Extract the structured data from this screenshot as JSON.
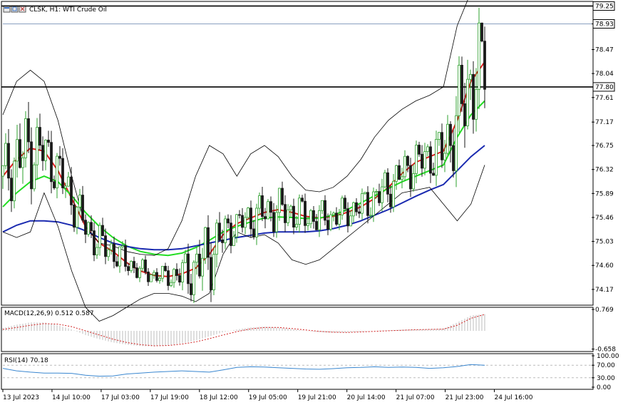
{
  "window": {
    "title": "CLSK, H1: WTI Crude Oil",
    "toolbar_icons": [
      "window-icon",
      "restore-icon",
      "close-icon"
    ]
  },
  "colors": {
    "bull": "#2ea02e",
    "bear": "#1a1a1a",
    "ma_red": "#dd1f1f",
    "ma_green": "#22dd22",
    "ma_blue": "#1a2ab0",
    "bands": "#000000",
    "grid": "#c8c8c8",
    "macd_hist": "#bdbdbd",
    "macd_signal": "#d02020",
    "rsi_line": "#3a87d0"
  },
  "chart_data": [
    {
      "type": "line",
      "title": "CLSK, H1: WTI Crude Oil",
      "y_axis_labels": [
        "78.93",
        "78.47",
        "78.04",
        "77.61",
        "77.17",
        "76.75",
        "76.32",
        "75.89",
        "75.46",
        "75.03",
        "74.60",
        "74.17"
      ],
      "ylim": [
        73.9,
        79.32
      ],
      "x_labels": [
        "13 Jul 2023",
        "14 Jul 10:00",
        "17 Jul 03:00",
        "17 Jul 19:00",
        "18 Jul 12:00",
        "19 Jul 05:00",
        "19 Jul 21:00",
        "20 Jul 14:00",
        "21 Jul 07:00",
        "21 Jul 23:00",
        "24 Jul 16:00"
      ],
      "current_price": "78.93",
      "levels": [
        {
          "label": "79.25",
          "value": 79.25
        },
        {
          "label": "77.80",
          "value": 77.8
        }
      ],
      "series": [
        {
          "name": "MA red",
          "values": [
            76.2,
            76.5,
            76.7,
            76.65,
            76.3,
            75.8,
            75.3,
            75.0,
            74.85,
            74.65,
            74.5,
            74.42,
            74.4,
            74.45,
            74.55,
            74.8,
            75.15,
            75.35,
            75.45,
            75.55,
            75.6,
            75.55,
            75.48,
            75.45,
            75.48,
            75.55,
            75.65,
            75.8,
            76.0,
            76.25,
            76.45,
            76.55,
            76.65,
            77.2,
            77.9,
            78.25
          ]
        },
        {
          "name": "MA green",
          "values": [
            75.65,
            75.9,
            76.1,
            76.2,
            76.1,
            75.85,
            75.55,
            75.3,
            75.1,
            74.95,
            74.85,
            74.8,
            74.78,
            74.82,
            74.92,
            75.05,
            75.2,
            75.3,
            75.38,
            75.45,
            75.47,
            75.46,
            75.44,
            75.45,
            75.5,
            75.6,
            75.72,
            75.85,
            75.98,
            76.1,
            76.2,
            76.3,
            76.4,
            76.9,
            77.3,
            77.55
          ]
        },
        {
          "name": "MA blue",
          "values": [
            75.2,
            75.32,
            75.4,
            75.4,
            75.38,
            75.32,
            75.22,
            75.1,
            75.0,
            74.94,
            74.9,
            74.88,
            74.88,
            74.9,
            74.95,
            75.0,
            75.05,
            75.1,
            75.14,
            75.18,
            75.2,
            75.2,
            75.2,
            75.22,
            75.26,
            75.32,
            75.4,
            75.5,
            75.6,
            75.72,
            75.84,
            75.95,
            76.05,
            76.3,
            76.55,
            76.75
          ]
        },
        {
          "name": "Band upper",
          "values": [
            77.3,
            77.9,
            78.1,
            77.9,
            77.2,
            76.2,
            75.3,
            75.0,
            74.95,
            74.85,
            74.8,
            74.78,
            74.9,
            75.4,
            76.2,
            76.75,
            76.6,
            76.2,
            76.6,
            76.75,
            76.55,
            76.2,
            75.95,
            75.92,
            76.0,
            76.2,
            76.5,
            76.9,
            77.2,
            77.4,
            77.55,
            77.65,
            77.8,
            78.9,
            79.5,
            79.6
          ]
        },
        {
          "name": "Band lower",
          "values": [
            75.2,
            75.1,
            75.2,
            75.9,
            75.3,
            74.5,
            73.85,
            73.6,
            73.7,
            73.85,
            74.0,
            74.1,
            74.1,
            74.05,
            73.95,
            74.1,
            74.8,
            75.2,
            75.1,
            75.15,
            75.0,
            74.7,
            74.62,
            74.7,
            74.9,
            75.1,
            75.3,
            75.5,
            75.7,
            75.9,
            75.95,
            76.0,
            75.7,
            75.4,
            75.7,
            76.4
          ]
        }
      ]
    },
    {
      "type": "bar",
      "title": "MACD(12,26,9) 0.512 0.587",
      "y_axis_labels": [
        "0.769",
        "-0.658"
      ],
      "ylim": [
        -0.72,
        0.82
      ],
      "values": [
        0.1,
        0.22,
        0.3,
        0.3,
        0.2,
        0.05,
        -0.15,
        -0.3,
        -0.42,
        -0.5,
        -0.55,
        -0.56,
        -0.52,
        -0.45,
        -0.35,
        -0.2,
        -0.05,
        0.05,
        0.12,
        0.15,
        0.12,
        0.06,
        0.0,
        -0.05,
        -0.07,
        -0.06,
        -0.03,
        0.0,
        0.02,
        0.04,
        0.05,
        0.06,
        0.08,
        0.3,
        0.55,
        0.6
      ],
      "signal": [
        0.05,
        0.12,
        0.2,
        0.26,
        0.24,
        0.15,
        0.0,
        -0.15,
        -0.3,
        -0.42,
        -0.5,
        -0.54,
        -0.53,
        -0.48,
        -0.4,
        -0.28,
        -0.15,
        -0.03,
        0.07,
        0.12,
        0.12,
        0.08,
        0.03,
        -0.02,
        -0.05,
        -0.06,
        -0.04,
        -0.02,
        0.0,
        0.02,
        0.04,
        0.05,
        0.06,
        0.2,
        0.45,
        0.59
      ]
    },
    {
      "type": "line",
      "title": "RSI(14) 70.18",
      "y_axis_labels": [
        "100.00",
        "70.00",
        "30.00",
        "0.00"
      ],
      "ylim": [
        0,
        100
      ],
      "levels": [
        70,
        30
      ],
      "values": [
        60,
        52,
        48,
        45,
        45,
        44,
        38,
        35,
        36,
        42,
        45,
        48,
        50,
        52,
        50,
        48,
        55,
        63,
        65,
        64,
        62,
        60,
        58,
        57,
        59,
        62,
        63,
        65,
        63,
        64,
        63,
        60,
        62,
        66,
        72,
        70
      ]
    }
  ]
}
